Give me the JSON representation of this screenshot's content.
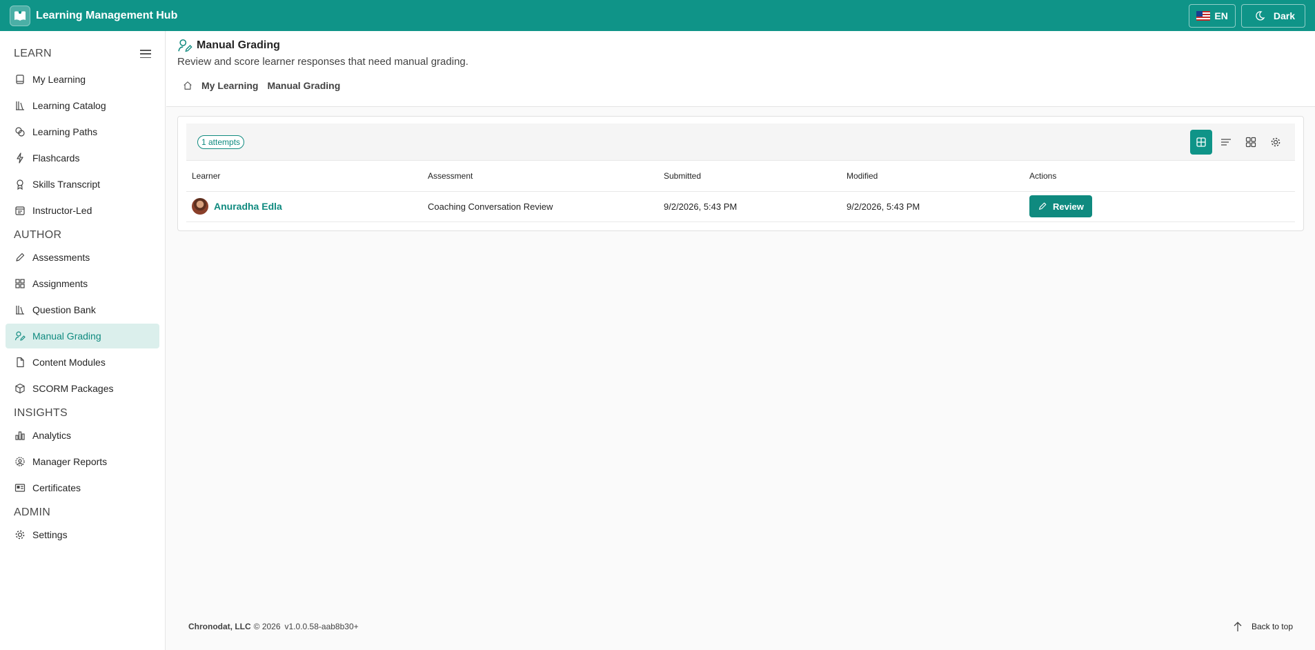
{
  "app": {
    "title": "Learning Management Hub"
  },
  "topbar": {
    "language": "EN",
    "theme_label": "Dark"
  },
  "sidebar": {
    "sections": [
      {
        "title": "LEARN",
        "items": [
          {
            "label": "My Learning",
            "icon": "book-icon"
          },
          {
            "label": "Learning Catalog",
            "icon": "library-icon"
          },
          {
            "label": "Learning Paths",
            "icon": "path-icon"
          },
          {
            "label": "Flashcards",
            "icon": "flash-icon"
          },
          {
            "label": "Skills Transcript",
            "icon": "ribbon-icon"
          },
          {
            "label": "Instructor-Led",
            "icon": "calendar-icon"
          }
        ]
      },
      {
        "title": "AUTHOR",
        "items": [
          {
            "label": "Assessments",
            "icon": "pencil-icon"
          },
          {
            "label": "Assignments",
            "icon": "grid-icon"
          },
          {
            "label": "Question Bank",
            "icon": "library-icon"
          },
          {
            "label": "Manual Grading",
            "icon": "grading-icon",
            "active": true
          },
          {
            "label": "Content Modules",
            "icon": "document-icon"
          },
          {
            "label": "SCORM Packages",
            "icon": "package-icon"
          }
        ]
      },
      {
        "title": "INSIGHTS",
        "items": [
          {
            "label": "Analytics",
            "icon": "bar-chart-icon"
          },
          {
            "label": "Manager Reports",
            "icon": "people-icon"
          },
          {
            "label": "Certificates",
            "icon": "certificate-icon"
          }
        ]
      },
      {
        "title": "ADMIN",
        "items": [
          {
            "label": "Settings",
            "icon": "gear-icon"
          }
        ]
      }
    ]
  },
  "header": {
    "title": "Manual Grading",
    "subtitle": "Review and score learner responses that need manual grading.",
    "breadcrumb": [
      "My Learning",
      "Manual Grading"
    ]
  },
  "grid": {
    "badge": "1 attempts",
    "columns": [
      "Learner",
      "Assessment",
      "Submitted",
      "Modified",
      "Actions"
    ],
    "rows": [
      {
        "learner": "Anuradha Edla",
        "assessment": "Coaching Conversation Review",
        "submitted": "9/2/2026, 5:43 PM",
        "modified": "9/2/2026, 5:43 PM",
        "action": "Review"
      }
    ]
  },
  "footer": {
    "company": "Chronodat, LLC",
    "copyright": "© 2026",
    "version": "v1.0.0.58-aab8b30+",
    "back_to_top": "Back to top"
  },
  "colors": {
    "brand": "#0f9488",
    "accent_text": "#0f8a7f",
    "active_bg": "#dbefec"
  }
}
